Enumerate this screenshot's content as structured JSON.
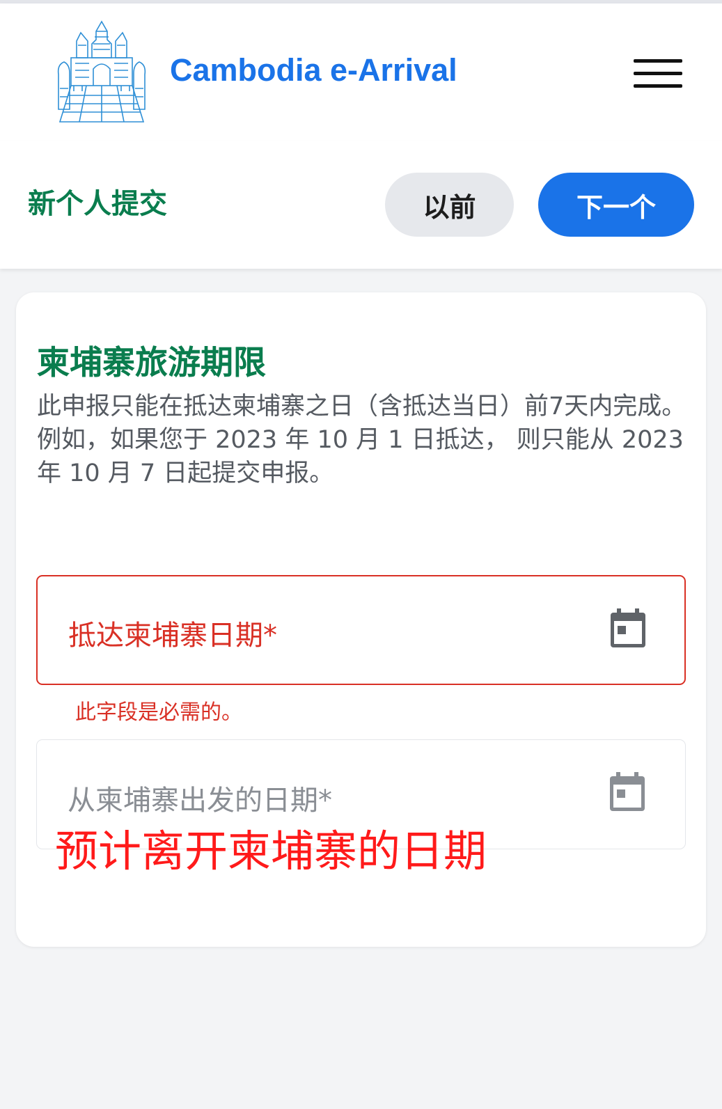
{
  "header": {
    "app_title": "Cambodia e-Arrival",
    "brand_color": "#1a73e8",
    "logo_icon": "angkor-temple-logo",
    "menu_icon": "hamburger-menu-icon"
  },
  "subbar": {
    "title": "新个人提交",
    "prev_label": "以前",
    "next_label": "下一个"
  },
  "section": {
    "title": "柬埔寨旅游期限",
    "desc_line1": "此申报只能在抵达柬埔寨之日（含抵达当日）前7天内完成。",
    "desc_line2": "例如，如果您于 2023 年 10 月 1 日抵达， 则只能从 2023 年 10 月 7 日起提交申报。"
  },
  "fields": {
    "arrival": {
      "label": "抵达柬埔寨日期*",
      "error": "此字段是必需的。",
      "icon": "calendar-icon"
    },
    "departure": {
      "label": "从柬埔寨出发的日期*",
      "icon": "calendar-icon"
    }
  },
  "annotation": "预计离开柬埔寨的日期",
  "colors": {
    "accent_green": "#0a7d4e",
    "error_red": "#d93025",
    "annotation_red": "#ff1a1a"
  }
}
